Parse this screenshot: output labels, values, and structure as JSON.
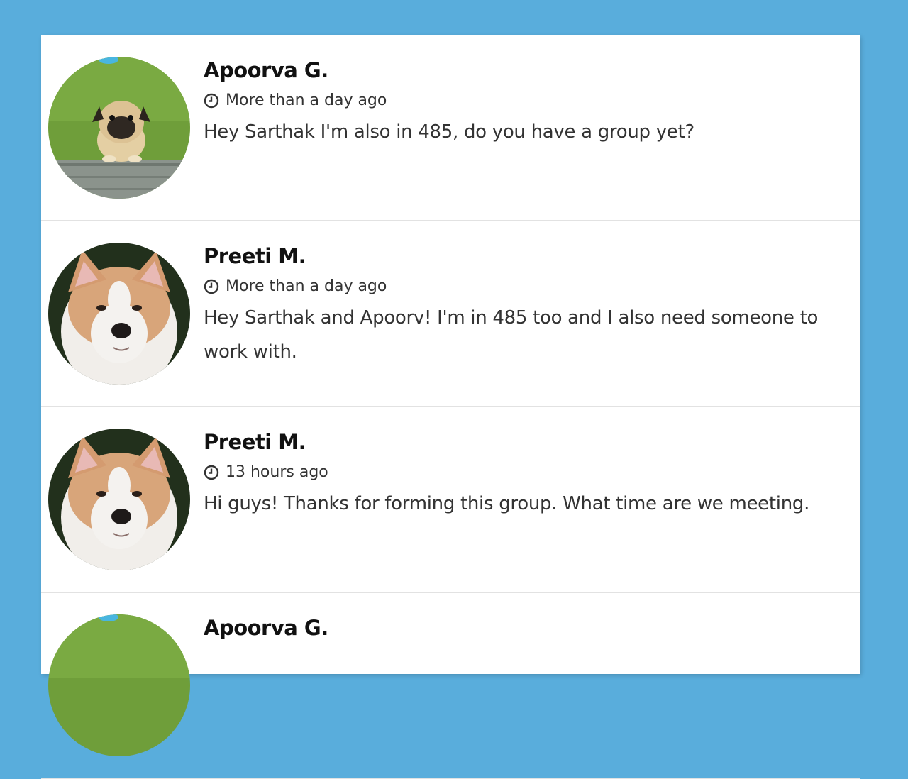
{
  "messages": [
    {
      "author": "Apoorva G.",
      "time": "More than a day ago",
      "text": "Hey Sarthak I'm also in 485, do you have a group yet?",
      "avatar": "pug-avatar"
    },
    {
      "author": "Preeti M.",
      "time": "More than a day ago",
      "text": "Hey Sarthak and Apoorv! I'm in 485 too and I also need someone to work with.",
      "avatar": "akita-avatar"
    },
    {
      "author": "Preeti M.",
      "time": "13 hours ago",
      "text": "Hi guys! Thanks for forming this group. What time are we meeting.",
      "avatar": "akita-avatar"
    },
    {
      "author": "Apoorva G.",
      "time": "",
      "text": "",
      "avatar": "pug-avatar"
    }
  ],
  "colors": {
    "background": "#59addc",
    "panel": "#ffffff",
    "divider": "#e2e2e2",
    "author_text": "#111111",
    "body_text": "#333333"
  },
  "icons": {
    "time": "clock-icon"
  }
}
